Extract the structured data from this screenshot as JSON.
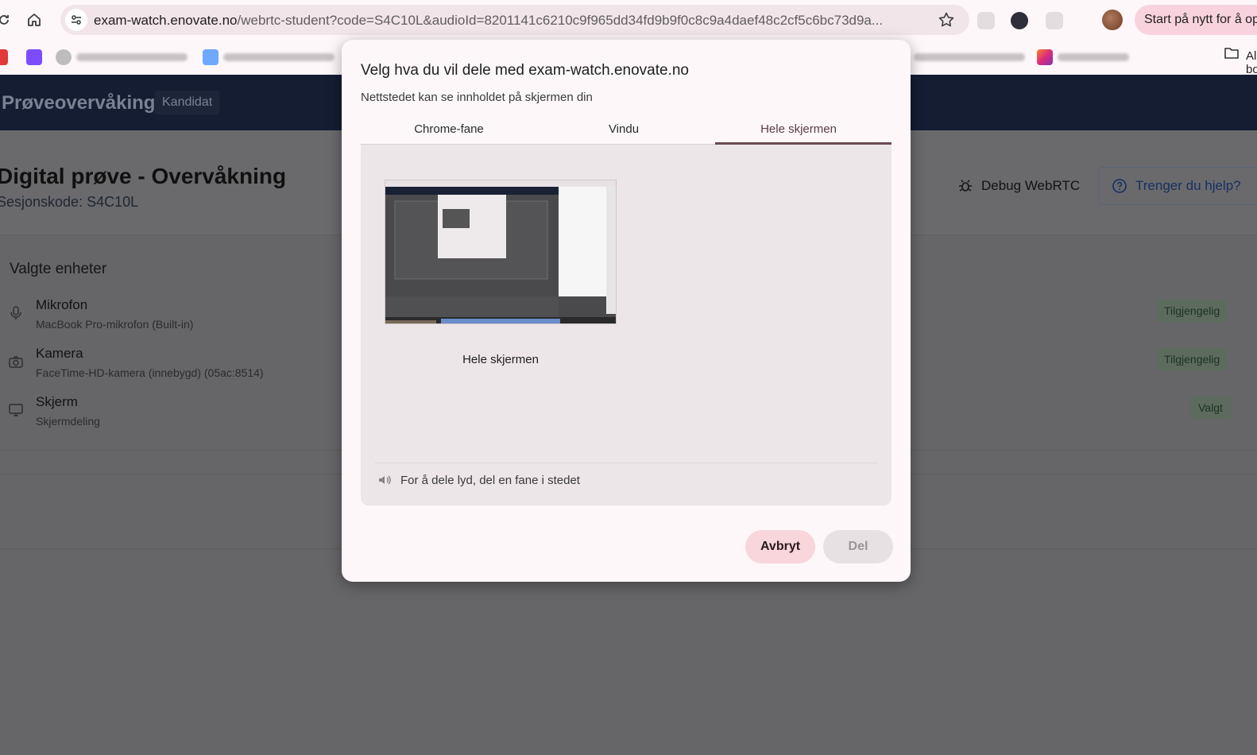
{
  "browser": {
    "url_host": "exam-watch.enovate.no",
    "url_path": "/webrtc-student?code=S4C10L&audioId=8201141c6210c9f965dd34fd9b9f0c8c9a4daef48c2cf5c6bc73d9a...",
    "restart_label": "Start på nytt for å oppdatere",
    "bookmarks_all_label": "Alle bokmerker"
  },
  "app": {
    "title": "Prøveovervåking",
    "role": "Kandidat",
    "exam_title": "Digital prøve - Overvåkning",
    "session_code": "Sesjonskode: S4C10L",
    "debug_label": "Debug WebRTC",
    "help_label": "Trenger du hjelp?",
    "devices_title": "Valgte enheter",
    "devices": [
      {
        "name": "Mikrofon",
        "detail": "MacBook Pro-mikrofon (Built-in)",
        "status": "Tilgjengelig",
        "icon": "microphone-icon"
      },
      {
        "name": "Kamera",
        "detail": "FaceTime-HD-kamera (innebygd) (05ac:8514)",
        "status": "Tilgjengelig",
        "icon": "camera-icon"
      },
      {
        "name": "Skjerm",
        "detail": "Skjermdeling",
        "status": "Valgt",
        "icon": "monitor-icon"
      }
    ]
  },
  "dialog": {
    "title": "Velg hva du vil dele med exam-watch.enovate.no",
    "subtitle": "Nettstedet kan se innholdet på skjermen din",
    "tabs": [
      "Chrome-fane",
      "Vindu",
      "Hele skjermen"
    ],
    "active_tab": "Hele skjermen",
    "source_label": "Hele skjermen",
    "audio_note": "For å dele lyd, del en fane i stedet",
    "cancel_label": "Avbryt",
    "share_label": "Del"
  }
}
